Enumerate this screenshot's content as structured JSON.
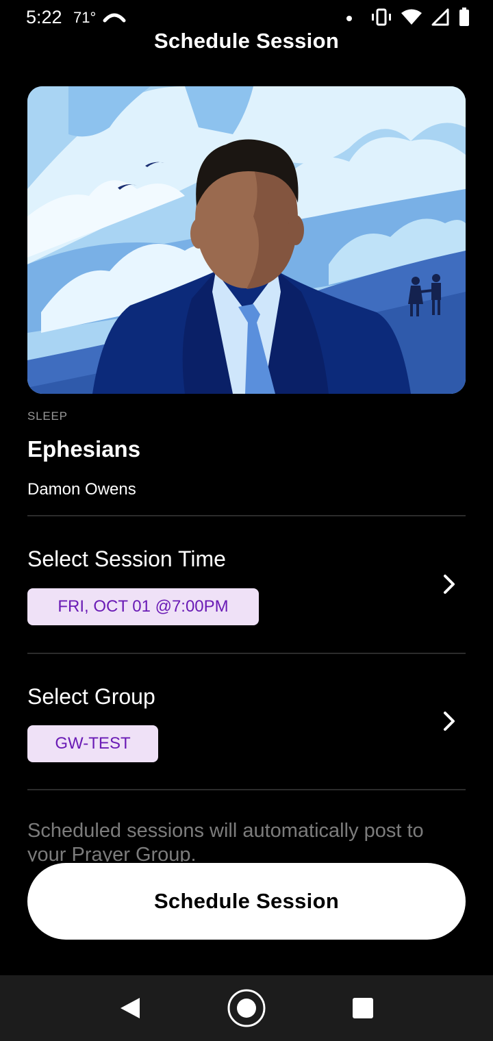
{
  "status_bar": {
    "time": "5:22",
    "temperature": "71°",
    "icons": [
      "cloud-icon",
      "notification-dot-icon",
      "vibrate-icon",
      "wifi-icon",
      "signal-icon",
      "battery-icon"
    ]
  },
  "header": {
    "title": "Schedule Session"
  },
  "session": {
    "category": "SLEEP",
    "title": "Ephesians",
    "author": "Damon Owens"
  },
  "time_row": {
    "label": "Select Session Time",
    "value": "FRI, OCT 01 @7:00PM"
  },
  "group_row": {
    "label": "Select Group",
    "value": "GW-TEST"
  },
  "note": "Scheduled sessions will automatically post to your Prayer Group.",
  "cta": {
    "label": "Schedule Session"
  },
  "nav": {
    "icons": [
      "back-icon",
      "home-icon",
      "recents-icon"
    ]
  },
  "colors": {
    "background": "#000000",
    "chip_background": "#efe1f7",
    "chip_text": "#6a1bb5",
    "cta_background": "#ffffff"
  }
}
